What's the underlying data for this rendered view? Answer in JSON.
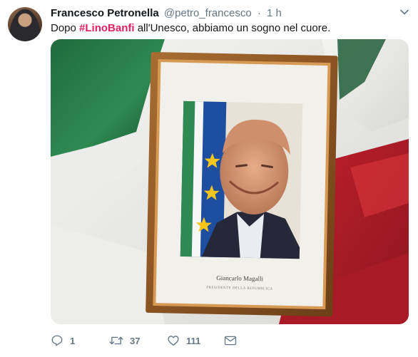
{
  "tweet": {
    "author": {
      "name": "Francesco Petronella",
      "handle": "@petro_francesco"
    },
    "separator": "·",
    "time": "1 h",
    "text": {
      "before": "Dopo ",
      "hashtag": "#LinoBanfi",
      "after": " all'Unesco, abbiamo un sogno nel cuore."
    },
    "photo": {
      "caption_name": "Giancarlo Magalli",
      "caption_title": "PRESIDENTE DELLA REPUBBLICA"
    },
    "actions": {
      "reply_count": "1",
      "retweet_count": "37",
      "like_count": "111"
    },
    "icons": {
      "caret": "chevron-down-icon",
      "reply": "reply-icon",
      "retweet": "retweet-icon",
      "like": "heart-icon",
      "message": "envelope-icon"
    },
    "colors": {
      "hashtag": "#e0245e",
      "muted": "#657786",
      "text": "#14171a"
    }
  }
}
